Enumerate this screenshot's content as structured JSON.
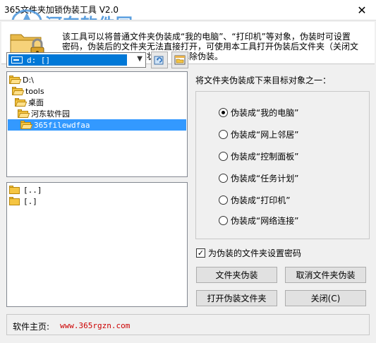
{
  "window": {
    "title": "365文件夹加锁伪装工具 V2.0",
    "close_glyph": "✕",
    "watermark": "河东软件园"
  },
  "banner": {
    "text": "该工具可以将普通文件夹伪装成“我的电脑”、“打印机”等对象，伪装时可设置密码，伪装后的文件夹无法直接打开，可使用本工具打开伪装后文件夹（关闭文件夹后自动恢复到伪装状态）或解除伪装。",
    "icon": "lock-folder-icon"
  },
  "drive": {
    "selected": "d: []"
  },
  "tree": {
    "items": [
      {
        "label": "D:\\",
        "level": 0,
        "selected": false
      },
      {
        "label": "tools",
        "level": 1,
        "selected": false
      },
      {
        "label": "桌面",
        "level": 2,
        "selected": false
      },
      {
        "label": "河东软件园",
        "level": 3,
        "selected": false
      },
      {
        "label": "365filewdfaa",
        "level": 4,
        "selected": true
      }
    ]
  },
  "files": {
    "items": [
      "[..]",
      "[.]"
    ]
  },
  "target": {
    "label": "将文件夹伪装成下来目标对象之一：",
    "options": [
      {
        "label": "伪装成“我的电脑”",
        "checked": true
      },
      {
        "label": "伪装成“网上邻居”",
        "checked": false
      },
      {
        "label": "伪装成“控制面板”",
        "checked": false
      },
      {
        "label": "伪装成“任务计划”",
        "checked": false
      },
      {
        "label": "伪装成“打印机”",
        "checked": false
      },
      {
        "label": "伪装成“网络连接”",
        "checked": false
      }
    ]
  },
  "password": {
    "label": "为伪装的文件夹设置密码",
    "checked": true,
    "check_glyph": "✓"
  },
  "buttons": {
    "disguise": "文件夹伪装",
    "undisguise": "取消文件夹伪装",
    "open": "打开伪装文件夹",
    "close": "关闭(C)"
  },
  "homepage": {
    "label": "软件主页:",
    "url": "www.365rgzn.com"
  }
}
